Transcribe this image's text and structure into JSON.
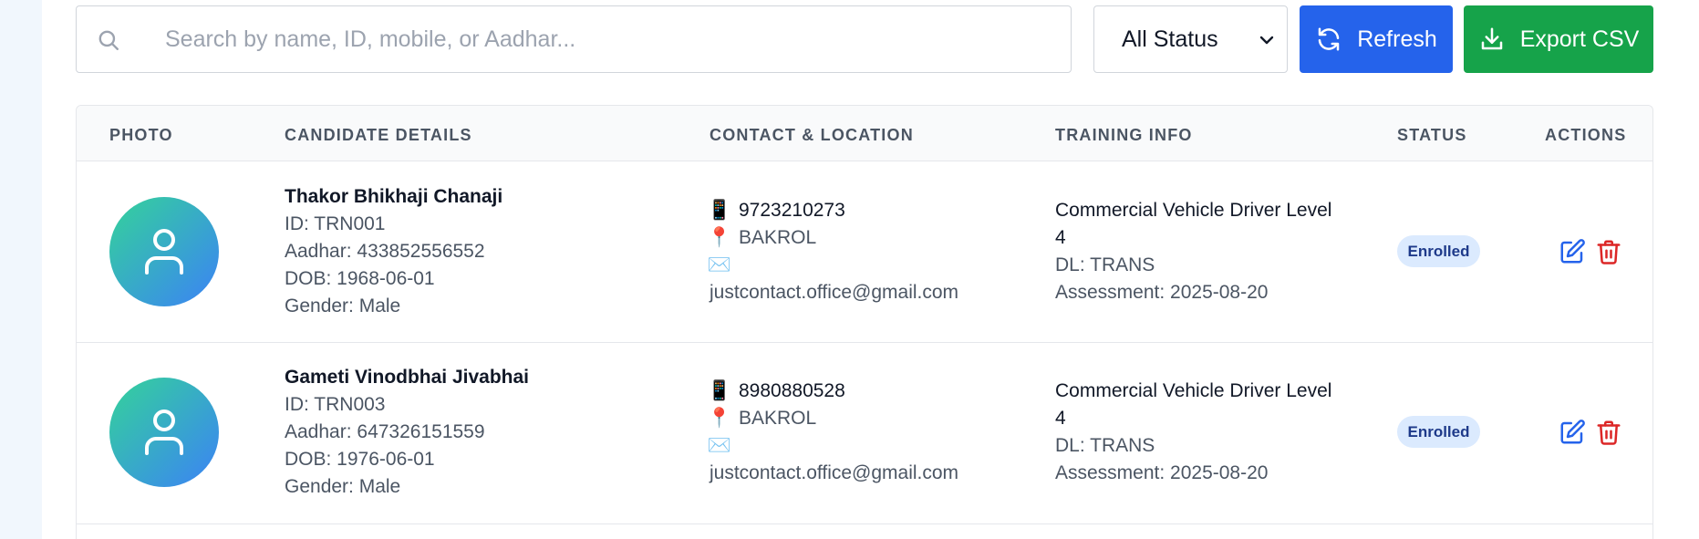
{
  "search": {
    "placeholder": "Search by name, ID, mobile, or Aadhar..."
  },
  "filters": {
    "status_selected": "All Status"
  },
  "toolbar": {
    "refresh_label": "Refresh",
    "export_label": "Export CSV"
  },
  "colors": {
    "refresh": "#2563eb",
    "export": "#16a34a",
    "badge_bg": "#dbeafe",
    "edit": "#2563eb",
    "delete": "#dc2626"
  },
  "table": {
    "headers": {
      "photo": "PHOTO",
      "details": "CANDIDATE DETAILS",
      "contact": "CONTACT & LOCATION",
      "training": "TRAINING INFO",
      "status": "STATUS",
      "actions": "ACTIONS"
    },
    "rows": [
      {
        "name": "Thakor Bhikhaji Chanaji",
        "id": "ID: TRN001",
        "aadhar": "Aadhar: 433852556552",
        "dob": "DOB: 1968-06-01",
        "gender": "Gender: Male",
        "phone": "9723210273",
        "location": "BAKROL",
        "email": "justcontact.office@gmail.com",
        "training_line1": "Commercial Vehicle Driver Level",
        "training_line2": "4",
        "dl": "DL: TRANS",
        "assessment": "Assessment: 2025-08-20",
        "status": "Enrolled"
      },
      {
        "name": "Gameti Vinodbhai Jivabhai",
        "id": "ID: TRN003",
        "aadhar": "Aadhar: 647326151559",
        "dob": "DOB: 1976-06-01",
        "gender": "Gender: Male",
        "phone": "8980880528",
        "location": "BAKROL",
        "email": "justcontact.office@gmail.com",
        "training_line1": "Commercial Vehicle Driver Level",
        "training_line2": "4",
        "dl": "DL: TRANS",
        "assessment": "Assessment: 2025-08-20",
        "status": "Enrolled"
      }
    ]
  },
  "icons": {
    "search": "search-icon",
    "refresh": "refresh-icon",
    "export": "download-icon",
    "avatar": "user-icon",
    "phone": "mobile-phone-icon",
    "location": "pin-icon",
    "email": "envelope-icon",
    "edit": "edit-icon",
    "delete": "trash-icon"
  }
}
